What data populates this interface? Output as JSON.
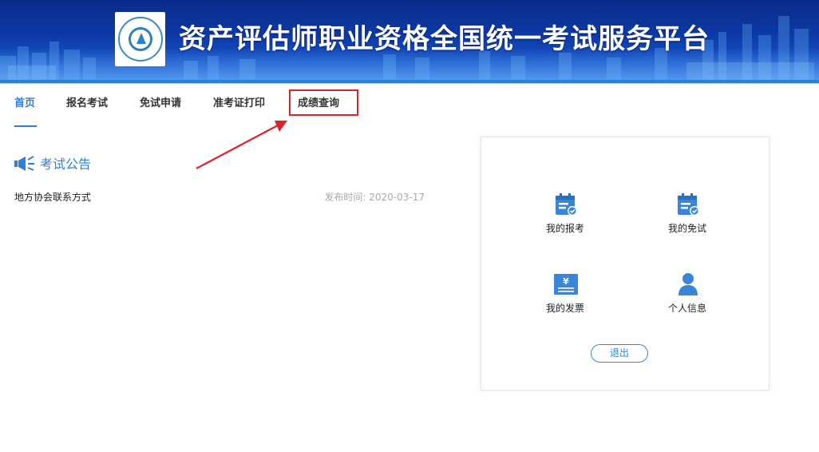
{
  "header": {
    "site_title": "资产评估师职业资格全国统一考试服务平台",
    "logo_icon": "association-logo-icon"
  },
  "nav": {
    "items": [
      {
        "label": "首页",
        "active": true
      },
      {
        "label": "报名考试",
        "active": false
      },
      {
        "label": "免试申请",
        "active": false
      },
      {
        "label": "准考证打印",
        "active": false
      },
      {
        "label": "成绩查询",
        "active": false,
        "highlighted": true
      }
    ]
  },
  "notices": {
    "title": "考试公告",
    "icon": "megaphone-icon",
    "items": [
      {
        "title": "地方协会联系方式",
        "date": "发布时间: 2020-03-17"
      }
    ]
  },
  "user_panel": {
    "tiles": [
      {
        "label": "我的报考",
        "icon": "calendar-check-icon"
      },
      {
        "label": "我的免试",
        "icon": "calendar-check-icon"
      },
      {
        "label": "我的发票",
        "icon": "invoice-yen-icon"
      },
      {
        "label": "个人信息",
        "icon": "user-icon"
      }
    ],
    "logout_label": "退出"
  },
  "colors": {
    "accent": "#2f7fd6",
    "highlight_box": "#d9232d",
    "banner": "#0d3aa8"
  }
}
